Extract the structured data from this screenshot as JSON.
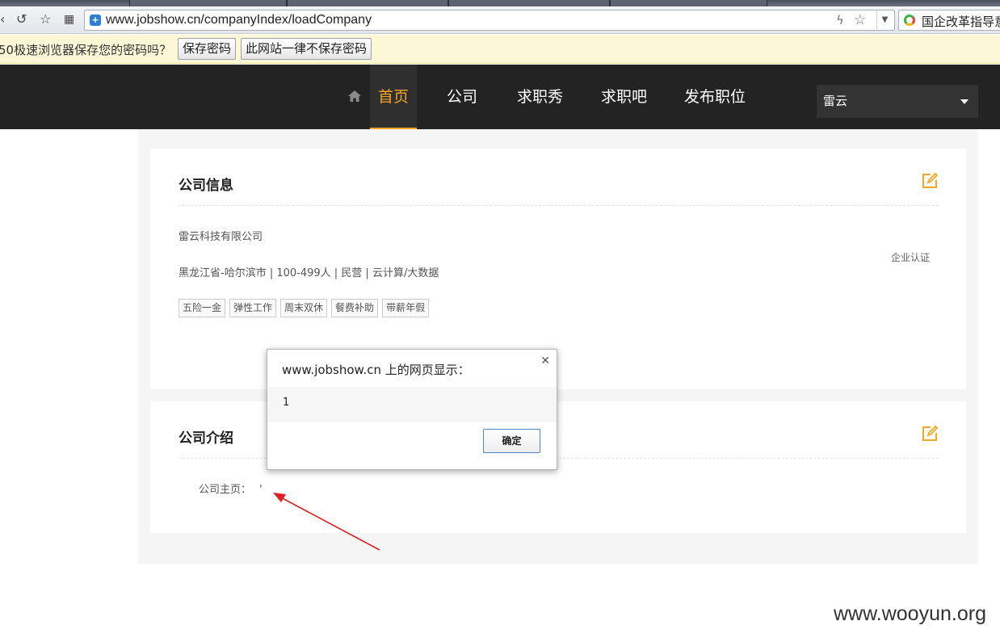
{
  "browser": {
    "url": "www.jobshow.cn/companyIndex/loadCompany",
    "search_text": "国企改革指导意",
    "password_bar": {
      "message": "50极速浏览器保存您的密码吗？",
      "save_label": "保存密码",
      "never_label": "此网站一律不保存密码"
    }
  },
  "header": {
    "nav": [
      "首页",
      "公司",
      "求职秀",
      "求职吧",
      "发布职位"
    ],
    "active_color": "#f5a623",
    "user": "雷云"
  },
  "company_info": {
    "title": "公司信息",
    "name": "雷云科技有限公司",
    "meta": "黑龙江省-哈尔滨市 | 100-499人 | 民营 | 云计算/大数据",
    "certification": "企业认证",
    "tags": [
      "五险一金",
      "弹性工作",
      "周末双休",
      "餐费补助",
      "带薪年假"
    ]
  },
  "company_intro": {
    "title": "公司介绍",
    "homepage_label": "公司主页：",
    "homepage_value": "'"
  },
  "dialog": {
    "title": "www.jobshow.cn 上的网页显示：",
    "message": "1",
    "ok_label": "确定"
  },
  "watermark": "www.wooyun.org"
}
